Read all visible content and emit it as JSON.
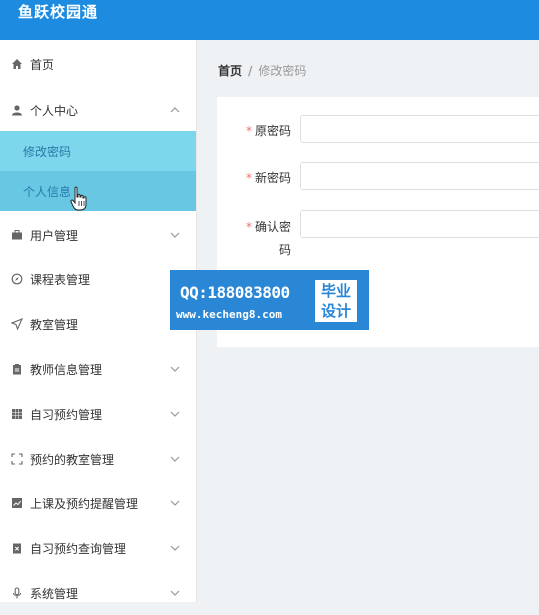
{
  "app": {
    "title": "鱼跃校园通"
  },
  "sidebar": {
    "items": [
      {
        "label": "首页",
        "icon": "home-icon"
      },
      {
        "label": "个人中心",
        "icon": "user-icon",
        "expanded": true,
        "children": [
          {
            "label": "修改密码",
            "active": true
          },
          {
            "label": "个人信息"
          }
        ]
      },
      {
        "label": "用户管理",
        "icon": "briefcase-icon"
      },
      {
        "label": "课程表管理",
        "icon": "compass-icon"
      },
      {
        "label": "教室管理",
        "icon": "send-icon"
      },
      {
        "label": "教师信息管理",
        "icon": "clipboard-icon"
      },
      {
        "label": "自习预约管理",
        "icon": "grid-icon"
      },
      {
        "label": "预约的教室管理",
        "icon": "fullscreen-icon"
      },
      {
        "label": "上课及预约提醒管理",
        "icon": "chart-icon"
      },
      {
        "label": "自习预约查询管理",
        "icon": "delete-doc-icon"
      },
      {
        "label": "系统管理",
        "icon": "microphone-icon"
      }
    ]
  },
  "breadcrumb": {
    "home": "首页",
    "separator": "/",
    "current": "修改密码"
  },
  "form": {
    "old_password": {
      "label": "原密码",
      "value": ""
    },
    "new_password": {
      "label": "新密码",
      "value": ""
    },
    "confirm_password": {
      "label": "确认密",
      "label2": "码",
      "value": ""
    },
    "required_mark": "*"
  },
  "watermark": {
    "qq": "QQ:188083800",
    "url": "www.kecheng8.com",
    "badge_line1": "毕业",
    "badge_line2": "设计"
  },
  "colors": {
    "header": "#1d8ce0",
    "submenu_active": "#7cd6ec",
    "submenu_hover": "#68c8e4",
    "required": "#f56c6c",
    "watermark": "#2a87d6"
  }
}
